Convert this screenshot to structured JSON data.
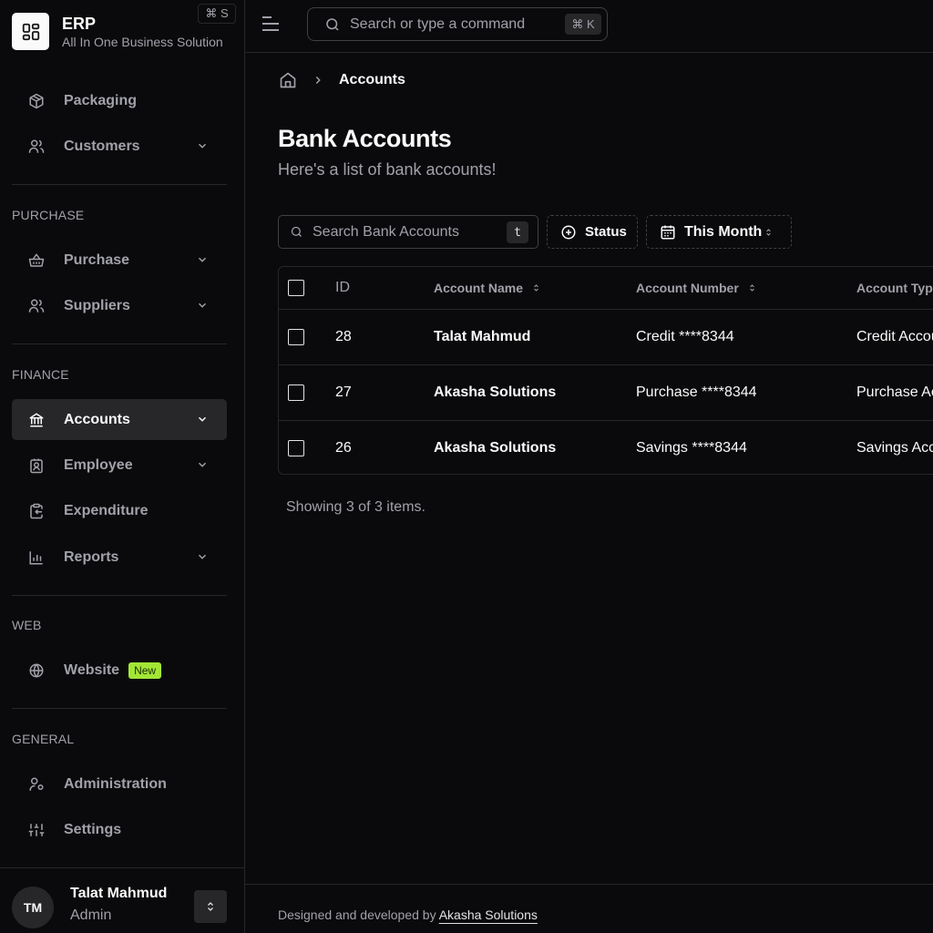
{
  "app": {
    "title": "ERP",
    "subtitle": "All In One Business Solution",
    "sidebar_shortcut": "⌘ S"
  },
  "sidebar": {
    "items_top": [
      {
        "label": "Packaging",
        "icon": "package-icon",
        "has_chevron": false
      },
      {
        "label": "Customers",
        "icon": "users-icon",
        "has_chevron": true
      }
    ],
    "sections": [
      {
        "label": "PURCHASE",
        "items": [
          {
            "label": "Purchase",
            "icon": "basket-icon",
            "has_chevron": true
          },
          {
            "label": "Suppliers",
            "icon": "users-icon",
            "has_chevron": true
          }
        ]
      },
      {
        "label": "FINANCE",
        "items": [
          {
            "label": "Accounts",
            "icon": "bank-icon",
            "has_chevron": true,
            "active": true
          },
          {
            "label": "Employee",
            "icon": "id-badge-icon",
            "has_chevron": true
          },
          {
            "label": "Expenditure",
            "icon": "clipboard-icon",
            "has_chevron": false
          },
          {
            "label": "Reports",
            "icon": "bar-chart-icon",
            "has_chevron": true
          }
        ]
      },
      {
        "label": "WEB",
        "items": [
          {
            "label": "Website",
            "icon": "globe-icon",
            "has_chevron": false,
            "badge": "New"
          }
        ]
      },
      {
        "label": "GENERAL",
        "items": [
          {
            "label": "Administration",
            "icon": "user-cog-icon",
            "has_chevron": false
          },
          {
            "label": "Settings",
            "icon": "sliders-icon",
            "has_chevron": false
          }
        ]
      }
    ],
    "user": {
      "initials": "TM",
      "name": "Talat Mahmud",
      "role": "Admin"
    }
  },
  "topbar": {
    "search_placeholder": "Search or type a command",
    "search_shortcut": "⌘ K"
  },
  "breadcrumb": {
    "current": "Accounts"
  },
  "page": {
    "title": "Bank Accounts",
    "subtitle": "Here's a list of bank accounts!"
  },
  "filters": {
    "search_placeholder": "Search Bank Accounts",
    "search_shortcut": "t",
    "status_label": "Status",
    "date_label": "This Month"
  },
  "table": {
    "columns": [
      "ID",
      "Account Name",
      "Account Number",
      "Account Type"
    ],
    "rows": [
      {
        "id": "28",
        "name": "Talat Mahmud",
        "number": "Credit ****8344",
        "type": "Credit Account"
      },
      {
        "id": "27",
        "name": "Akasha Solutions",
        "number": "Purchase ****8344",
        "type": "Purchase Account"
      },
      {
        "id": "26",
        "name": "Akasha Solutions",
        "number": "Savings ****8344",
        "type": "Savings Account"
      }
    ],
    "summary": "Showing 3 of 3 items."
  },
  "footer": {
    "prefix": "Designed and developed by",
    "link": "Akasha Solutions"
  },
  "colors": {
    "background": "#0a0a0c",
    "border": "#27272a",
    "muted_text": "#a1a1aa",
    "badge_new": "#a3e635"
  }
}
